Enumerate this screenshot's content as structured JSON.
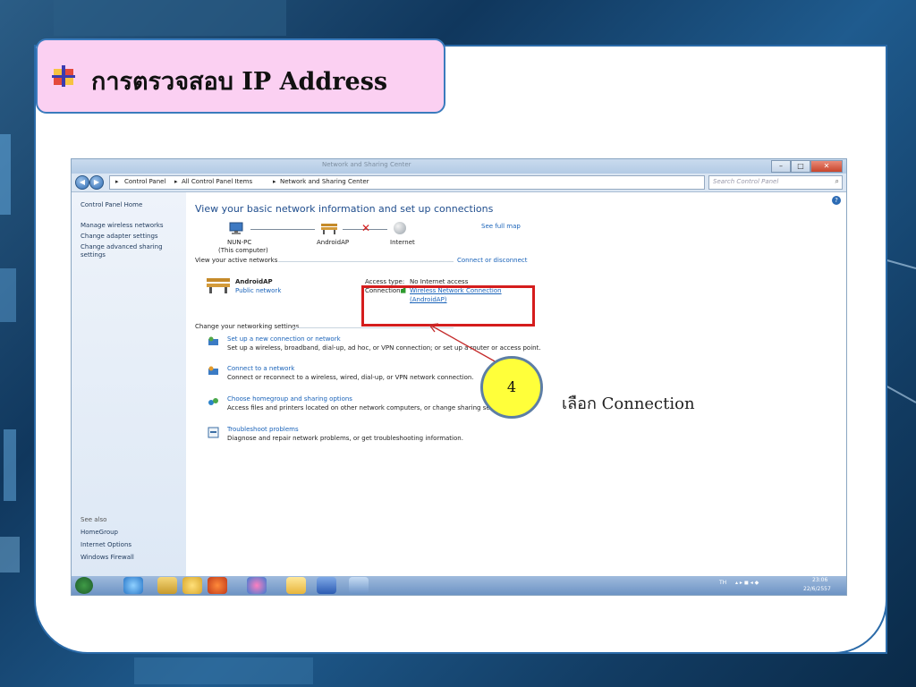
{
  "slide": {
    "title": "การตรวจสอบ IP Address",
    "caption": "เลือก  Connection",
    "callout_number": "4"
  },
  "window": {
    "title": "Network and Sharing Center",
    "breadcrumb": [
      "Control Panel",
      "All Control Panel Items",
      "Network and Sharing Center"
    ],
    "search_placeholder": "Search Control Panel"
  },
  "sidebar": {
    "items": [
      "Control Panel Home",
      "Manage wireless networks",
      "Change adapter settings",
      "Change advanced sharing",
      "settings"
    ],
    "see_also_label": "See also",
    "see_also": [
      "HomeGroup",
      "Internet Options",
      "Windows Firewall"
    ]
  },
  "main": {
    "heading": "View your basic network information and set up connections",
    "see_full_map": "See full map",
    "map": {
      "computer": "NUN-PC",
      "computer_sub": "(This computer)",
      "network": "AndroidAP",
      "internet": "Internet"
    },
    "active_networks_label": "View your active networks",
    "connect_disconnect": "Connect or disconnect",
    "active_network": {
      "name": "AndroidAP",
      "type": "Public network",
      "access_type_label": "Access type:",
      "access_type_value": "No Internet access",
      "connections_label": "Connections:",
      "connection_link_1": "Wireless Network Connection",
      "connection_link_2": "(AndroidAP)"
    },
    "change_settings_label": "Change your networking settings",
    "settings": [
      {
        "link": "Set up a new connection or network",
        "desc": "Set up a wireless, broadband, dial-up, ad hoc, or VPN connection; or set up a router or access point."
      },
      {
        "link": "Connect to a network",
        "desc": "Connect or reconnect to a wireless, wired, dial-up, or VPN network connection."
      },
      {
        "link": "Choose homegroup and sharing options",
        "desc": "Access files and printers located on other network computers, or change sharing settings."
      },
      {
        "link": "Troubleshoot problems",
        "desc": "Diagnose and repair network problems, or get troubleshooting information."
      }
    ]
  },
  "taskbar": {
    "lang": "TH",
    "time": "23:06",
    "date": "22/6/2557"
  },
  "colors": {
    "title_box": "#fbd0f2",
    "highlight_box": "#d51d1d",
    "callout_fill": "#ffff3a",
    "link": "#1a63b9"
  }
}
